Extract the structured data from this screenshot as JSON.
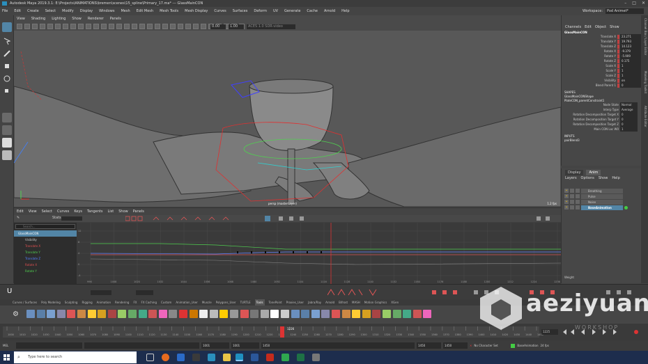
{
  "window": {
    "title": "Autodesk Maya 2019.3.1: E:\\Projects\\ANIMATIONS\\bremen\\scenes\\15_spline\\Primary_17.ma*   ---   GlassMainCON",
    "buttons": [
      "–",
      "□",
      "✕"
    ]
  },
  "menubar": {
    "items": [
      "File",
      "Edit",
      "Create",
      "Select",
      "Modify",
      "Display",
      "Windows",
      "Mesh",
      "Edit Mesh",
      "Mesh Tools",
      "Mesh Display",
      "Curves",
      "Surfaces",
      "Deform",
      "UV",
      "Generate",
      "Cache",
      "Arnold",
      "Help"
    ],
    "workspace_label": "Workspace:",
    "workspace_value": "Pod Animet*"
  },
  "viewport": {
    "menu": [
      "View",
      "Shading",
      "Lighting",
      "Show",
      "Renderer",
      "Panels"
    ],
    "field_a": "0.00",
    "field_b": "1.00",
    "colorspace": "ACES 1.0 SDR-video",
    "camera_label": "persp (masterLayer)",
    "fps": "1.2 fps"
  },
  "graph_editor": {
    "menu": [
      "Edit",
      "View",
      "Select",
      "Curves",
      "Keys",
      "Tangents",
      "List",
      "Show",
      "Panels"
    ],
    "stats_label": "Stats",
    "search_placeholder": "Search...",
    "outliner": [
      {
        "label": "GlassMainCON",
        "color": "#ffffff",
        "selected": true
      },
      {
        "label": "Visibility",
        "color": "#cccccc"
      },
      {
        "label": "Translate X",
        "color": "#e05050"
      },
      {
        "label": "Translate Y",
        "color": "#50d050"
      },
      {
        "label": "Translate Z",
        "color": "#5080ff"
      },
      {
        "label": "Rotate X",
        "color": "#e05050"
      },
      {
        "label": "Rotate Y",
        "color": "#50d050"
      }
    ],
    "ruler": [
      "996",
      "1008",
      "1020",
      "1032",
      "1044",
      "1056",
      "1068",
      "1080",
      "1092",
      "1104",
      "1116",
      "1128",
      "1140",
      "1152",
      "1164",
      "1176",
      "1188",
      "1200",
      "1212",
      "1224",
      "1236"
    ],
    "y_labels": [
      "12",
      "8",
      "4",
      "0",
      "-4"
    ]
  },
  "channel_box": {
    "tabs": [
      "Channels",
      "Edit",
      "Object",
      "Show"
    ],
    "object": "GlassMainCON",
    "channels": [
      {
        "name": "Translate X",
        "value": "23.271"
      },
      {
        "name": "Translate Y",
        "value": "19.793"
      },
      {
        "name": "Translate Z",
        "value": "14.123"
      },
      {
        "name": "Rotate X",
        "value": "-9.379"
      },
      {
        "name": "Rotate Y",
        "value": "-5.909"
      },
      {
        "name": "Rotate Z",
        "value": "0.175"
      },
      {
        "name": "Scale X",
        "value": "1"
      },
      {
        "name": "Scale Y",
        "value": "1"
      },
      {
        "name": "Scale Z",
        "value": "1"
      },
      {
        "name": "Visibility",
        "value": "on"
      },
      {
        "name": "Blend Parent 1",
        "value": "0"
      }
    ],
    "shapes_header": "SHAPES",
    "shape_name": "GlassMainCONShape",
    "constraint_name": "PlateCON_parentConstraint1",
    "constraint_attrs": [
      {
        "name": "Node State",
        "value": "Normal"
      },
      {
        "name": "Interp Type",
        "value": "Average"
      },
      {
        "name": "Rotation Decomposition Target X",
        "value": "0"
      },
      {
        "name": "Rotation Decomposition Target Y",
        "value": "0"
      },
      {
        "name": "Rotation Decomposition Target Z",
        "value": "0"
      },
      {
        "name": "Main CON Loc W0",
        "value": "1"
      }
    ],
    "inputs_header": "INPUTS",
    "input_name": "pairBlend3"
  },
  "layer_editor": {
    "tabs": [
      "Display",
      "Anim"
    ],
    "menu": [
      "Layers",
      "Options",
      "Show",
      "Help"
    ],
    "layers": [
      {
        "name": "Breathing",
        "selected": false
      },
      {
        "name": "Pulse",
        "selected": false
      },
      {
        "name": "Noise",
        "selected": false
      },
      {
        "name": "BaseAnimation",
        "selected": true
      }
    ],
    "weight_label": "Weight"
  },
  "side_tabs": [
    "Channel Box / Layer Editor",
    "Modeling Toolkit",
    "Attribute Editor"
  ],
  "shelf": {
    "tabs": [
      "Curves / Surfaces",
      "Poly Modeling",
      "Sculpting",
      "Rigging",
      "Animation",
      "Rendering",
      "FX",
      "FX Caching",
      "Custom",
      "Animation_User",
      "Muscle",
      "Polygons_User",
      "TURTLE",
      "Tools",
      "TonePoint",
      "Proxies_User",
      "Jabra/Ray",
      "Arnold",
      "Bifrost",
      "MASH",
      "Motion Graphics",
      "XGen"
    ],
    "active_tab": "Tools"
  },
  "time_slider": {
    "ticks": [
      "1000",
      "1010",
      "1020",
      "1030",
      "1040",
      "1050",
      "1060",
      "1070",
      "1080",
      "1090",
      "1100",
      "1110",
      "1120",
      "1130",
      "1140",
      "1150",
      "1160",
      "1170",
      "1180",
      "1190",
      "1200",
      "1210",
      "1220",
      "1230",
      "1240",
      "1250",
      "1260",
      "1270",
      "1280",
      "1290",
      "1300",
      "1310",
      "1320",
      "1330",
      "1340",
      "1350",
      "1360",
      "1370",
      "1380",
      "1390",
      "1400",
      "1410",
      "1420",
      "1430",
      "1440",
      "1450"
    ],
    "current_frame": "1225",
    "current_marker": "1226"
  },
  "range_bar": {
    "mel_label": "MEL",
    "start": "1001",
    "inner_start": "1001",
    "inner_end": "1450",
    "end": "1450",
    "end_b": "1450",
    "character_set": "No Character Set",
    "anim_layer": "BaseAnimation",
    "fps": "24 fps"
  },
  "taskbar": {
    "search_placeholder": "Type here to search"
  },
  "watermark": {
    "text": "aeziyuan",
    "sub": "WORKSHOP"
  },
  "colors": {
    "maya_bg": "#444444",
    "viewport_bg": "#575757",
    "selection": "#5285a6",
    "taskbar": "#1d2d4d",
    "timeline_marker": "#d33333"
  }
}
